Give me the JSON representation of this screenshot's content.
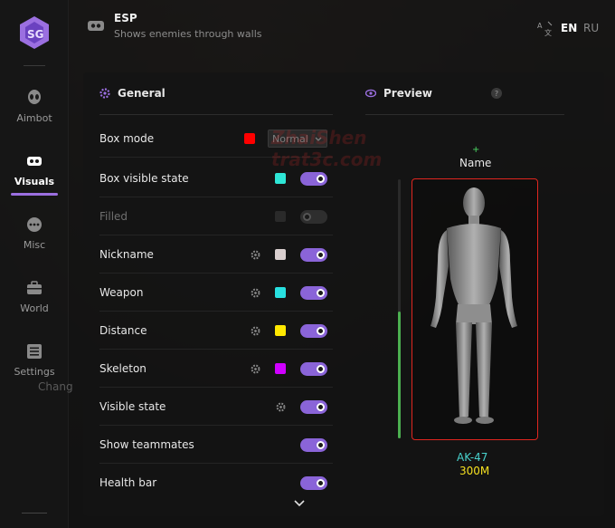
{
  "header": {
    "title": "ESP",
    "subtitle": "Shows enemies through walls",
    "lang_en": "EN",
    "lang_ru": "RU"
  },
  "sidebar": {
    "items": [
      {
        "label": "Aimbot",
        "icon": "alien-icon"
      },
      {
        "label": "Visuals",
        "icon": "vr-headset-icon",
        "active": true
      },
      {
        "label": "Misc",
        "icon": "dots-icon"
      },
      {
        "label": "World",
        "icon": "briefcase-icon"
      },
      {
        "label": "Settings",
        "icon": "list-icon"
      }
    ],
    "changelog_label": "Chang"
  },
  "general": {
    "title": "General",
    "rows": [
      {
        "label": "Box mode",
        "color": "#ff0000",
        "select": "Normal"
      },
      {
        "label": "Box visible state",
        "color": "#2ee6d6",
        "toggle": true
      },
      {
        "label": "Filled",
        "color": "#2a2a2a",
        "toggle": false,
        "disabled": true
      },
      {
        "label": "Nickname",
        "gear": true,
        "color": "#d9cfcf",
        "toggle": true
      },
      {
        "label": "Weapon",
        "gear": true,
        "color": "#28e0e0",
        "toggle": true
      },
      {
        "label": "Distance",
        "gear": true,
        "color": "#ffe800",
        "toggle": true
      },
      {
        "label": "Skeleton",
        "gear": true,
        "color": "#d000ff",
        "toggle": true
      },
      {
        "label": "Visible state",
        "gear": true,
        "toggle": true
      },
      {
        "label": "Show teammates",
        "toggle": true
      },
      {
        "label": "Health bar",
        "toggle": true
      }
    ]
  },
  "preview": {
    "title": "Preview",
    "help": "?",
    "plus": "+",
    "name_label": "Name",
    "weapon_label": "AK-47",
    "distance_label": "300M",
    "box_color": "#e0261f",
    "health_color": "#4caf50"
  },
  "watermark": {
    "line1": "ZhaiShen",
    "line2": "trat3c.com"
  },
  "colors": {
    "accent": "#8a64d8"
  }
}
